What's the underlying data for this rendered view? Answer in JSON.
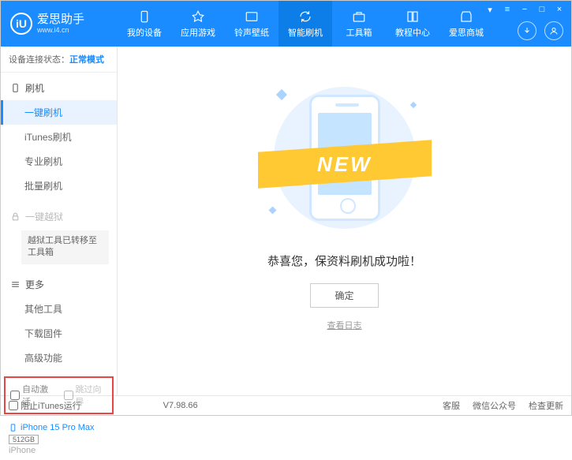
{
  "header": {
    "logo_text": "爱思助手",
    "logo_sub": "www.i4.cn",
    "logo_letter": "iU",
    "nav": [
      {
        "label": "我的设备"
      },
      {
        "label": "应用游戏"
      },
      {
        "label": "铃声壁纸"
      },
      {
        "label": "智能刷机"
      },
      {
        "label": "工具箱"
      },
      {
        "label": "教程中心"
      },
      {
        "label": "爱思商城"
      }
    ]
  },
  "sidebar": {
    "status_label": "设备连接状态：",
    "status_value": "正常模式",
    "sections": {
      "flash": {
        "title": "刷机",
        "items": [
          "一键刷机",
          "iTunes刷机",
          "专业刷机",
          "批量刷机"
        ]
      },
      "jailbreak": {
        "title": "一键越狱",
        "boxed": "越狱工具已转移至工具箱"
      },
      "more": {
        "title": "更多",
        "items": [
          "其他工具",
          "下载固件",
          "高级功能"
        ]
      }
    },
    "checkboxes": {
      "auto_activate": "自动激活",
      "skip_guide": "跳过向导"
    },
    "device": {
      "name": "iPhone 15 Pro Max",
      "storage": "512GB",
      "type": "iPhone"
    }
  },
  "main": {
    "ribbon": "NEW",
    "success": "恭喜您，保资料刷机成功啦！",
    "ok": "确定",
    "log": "查看日志"
  },
  "footer": {
    "block_itunes": "阻止iTunes运行",
    "version": "V7.98.66",
    "links": [
      "客服",
      "微信公众号",
      "检查更新"
    ]
  }
}
